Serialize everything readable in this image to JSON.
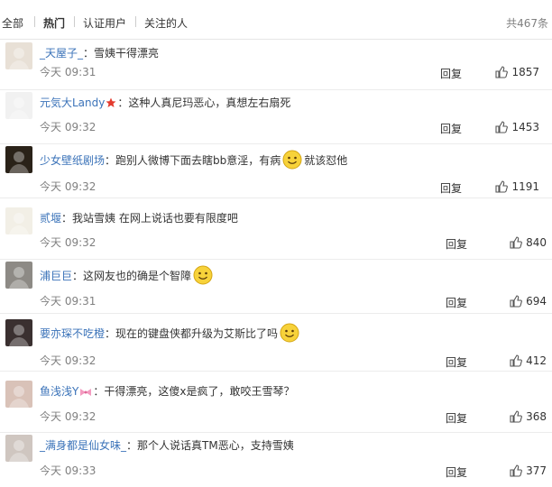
{
  "filters": {
    "tabs": [
      "全部",
      "热门",
      "认证用户",
      "关注的人"
    ],
    "active": "热门",
    "total": "共467条"
  },
  "actions": {
    "reply_label": "回复"
  },
  "comments": [
    {
      "user": "_天屋子_",
      "sep": "：",
      "text": "雪姨干得漂亮",
      "time": "今天 09:31",
      "likes": "1857",
      "avatar_color": "#e8e0d6",
      "badge": false,
      "emoji": false
    },
    {
      "user": "元気大Landy",
      "sep": "：",
      "text": "这种人真尼玛恶心，真想左右扇死",
      "time": "今天 09:32",
      "likes": "1453",
      "avatar_color": "#f1f1f1",
      "badge": true,
      "emoji": false
    },
    {
      "user": "少女壁纸剧场",
      "sep": "：",
      "text": "跑别人微博下面去瞎bb意淫，有病",
      "text_after": "就该怼他",
      "time": "今天 09:32",
      "likes": "1191",
      "avatar_color": "#2a2218",
      "badge": false,
      "emoji": true
    },
    {
      "user": "贰堰",
      "sep": "：",
      "text": "我站雪姨 在网上说话也要有限度吧",
      "time": "今天 09:32",
      "likes": "840",
      "avatar_color": "#f2efe6",
      "badge": false,
      "emoji": false
    },
    {
      "user": "浦巨巨",
      "sep": "：",
      "text": "这网友也的确是个智障",
      "text_after": "",
      "time": "今天 09:31",
      "likes": "694",
      "avatar_color": "#8d8a85",
      "badge": false,
      "emoji": true
    },
    {
      "user": "要亦琛不吃橙",
      "sep": "：",
      "text": "现在的键盘侠都升级为艾斯比了吗",
      "text_after": "",
      "time": "今天 09:32",
      "likes": "412",
      "avatar_color": "#3a3030",
      "badge": false,
      "emoji": true
    },
    {
      "user": "鱼浅浅Y",
      "sep": "：",
      "text": "干得漂亮，这傻x是疯了，敢咬王雪琴？",
      "time": "今天 09:32",
      "likes": "368",
      "avatar_color": "#d9c2b8",
      "badge": true,
      "emoji": false
    },
    {
      "user": "_满身都是仙女味_",
      "sep": "：",
      "text": "那个人说话真TM恶心，支持雪姨",
      "time": "今天 09:33",
      "likes": "377",
      "avatar_color": "#cfc6c0",
      "badge": false,
      "emoji": false
    }
  ]
}
